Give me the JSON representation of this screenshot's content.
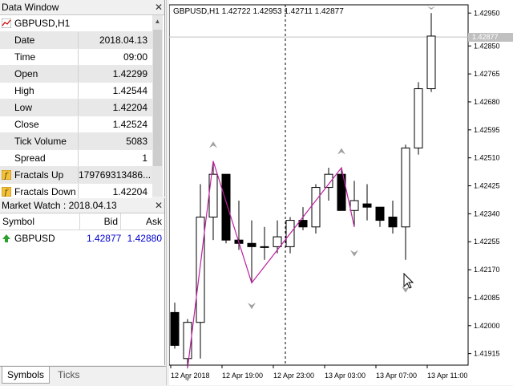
{
  "data_window": {
    "title": "Data Window",
    "symbol": "GBPUSD,H1",
    "rows": [
      {
        "key": "Date",
        "value": "2018.04.13"
      },
      {
        "key": "Time",
        "value": "09:00"
      },
      {
        "key": "Open",
        "value": "1.42299"
      },
      {
        "key": "High",
        "value": "1.42544"
      },
      {
        "key": "Low",
        "value": "1.42204"
      },
      {
        "key": "Close",
        "value": "1.42524"
      },
      {
        "key": "Tick Volume",
        "value": "5083"
      },
      {
        "key": "Spread",
        "value": "1"
      },
      {
        "key": "Fractals Up",
        "value": "179769313486..."
      },
      {
        "key": "Fractals Down",
        "value": "1.42204"
      }
    ]
  },
  "market_watch": {
    "title": "Market Watch : 2018.04.13",
    "headers": {
      "symbol": "Symbol",
      "bid": "Bid",
      "ask": "Ask"
    },
    "rows": [
      {
        "symbol": "GBPUSD",
        "bid": "1.42877",
        "ask": "1.42880"
      }
    ]
  },
  "tabs": {
    "symbols": "Symbols",
    "ticks": "Ticks"
  },
  "chart": {
    "info": "GBPUSD,H1  1.42722 1.42953 1.42711 1.42877",
    "current_price": "1.42877",
    "price_labels": [
      "1.42950",
      "1.42850",
      "1.42765",
      "1.42680",
      "1.42595",
      "1.42510",
      "1.42425",
      "1.42340",
      "1.42255",
      "1.42170",
      "1.42085",
      "1.42000",
      "1.41915"
    ],
    "time_labels": [
      "12 Apr 2018",
      "12 Apr 19:00",
      "12 Apr 23:00",
      "13 Apr 03:00",
      "13 Apr 07:00",
      "13 Apr 11:00"
    ]
  },
  "chart_data": {
    "type": "candlestick",
    "symbol": "GBPUSD",
    "timeframe": "H1",
    "ylim": [
      1.4187,
      1.4299
    ],
    "candles": [
      {
        "o": 1.4204,
        "h": 1.4207,
        "l": 1.4193,
        "c": 1.4194
      },
      {
        "o": 1.419,
        "h": 1.4202,
        "l": 1.4187,
        "c": 1.4201
      },
      {
        "o": 1.4201,
        "h": 1.4243,
        "l": 1.419,
        "c": 1.4233
      },
      {
        "o": 1.4233,
        "h": 1.425,
        "l": 1.4226,
        "c": 1.4246
      },
      {
        "o": 1.4246,
        "h": 1.4246,
        "l": 1.4225,
        "c": 1.4226
      },
      {
        "o": 1.4226,
        "h": 1.4238,
        "l": 1.4223,
        "c": 1.4225
      },
      {
        "o": 1.4225,
        "h": 1.4232,
        "l": 1.4213,
        "c": 1.4224
      },
      {
        "o": 1.4224,
        "h": 1.423,
        "l": 1.422,
        "c": 1.4224
      },
      {
        "o": 1.4224,
        "h": 1.4232,
        "l": 1.4222,
        "c": 1.4227
      },
      {
        "o": 1.4224,
        "h": 1.4233,
        "l": 1.4222,
        "c": 1.4232
      },
      {
        "o": 1.4232,
        "h": 1.4236,
        "l": 1.4229,
        "c": 1.423
      },
      {
        "o": 1.423,
        "h": 1.4243,
        "l": 1.4228,
        "c": 1.4242
      },
      {
        "o": 1.4242,
        "h": 1.4248,
        "l": 1.4238,
        "c": 1.4246
      },
      {
        "o": 1.4246,
        "h": 1.4248,
        "l": 1.4235,
        "c": 1.4235
      },
      {
        "o": 1.4235,
        "h": 1.4244,
        "l": 1.423,
        "c": 1.4238
      },
      {
        "o": 1.4237,
        "h": 1.4243,
        "l": 1.4232,
        "c": 1.4236
      },
      {
        "o": 1.4236,
        "h": 1.4236,
        "l": 1.423,
        "c": 1.4232
      },
      {
        "o": 1.4233,
        "h": 1.4238,
        "l": 1.4228,
        "c": 1.423
      },
      {
        "o": 1.423,
        "h": 1.4255,
        "l": 1.422,
        "c": 1.4254
      },
      {
        "o": 1.4254,
        "h": 1.4274,
        "l": 1.4252,
        "c": 1.4272
      },
      {
        "o": 1.4272,
        "h": 1.4295,
        "l": 1.4271,
        "c": 1.4288
      }
    ],
    "fractals_up": [
      {
        "index": 3,
        "price": 1.4255
      },
      {
        "index": 13,
        "price": 1.4253
      }
    ],
    "fractals_down": [
      {
        "index": 1,
        "price": 1.4184
      },
      {
        "index": 6,
        "price": 1.4206
      },
      {
        "index": 14,
        "price": 1.4222
      },
      {
        "index": 18,
        "price": 1.4211
      }
    ],
    "zigzag": [
      {
        "index": 1,
        "price": 1.4187
      },
      {
        "index": 3,
        "price": 1.425
      },
      {
        "index": 6,
        "price": 1.4213
      },
      {
        "index": 13,
        "price": 1.4248
      },
      {
        "index": 14,
        "price": 1.423
      }
    ]
  }
}
